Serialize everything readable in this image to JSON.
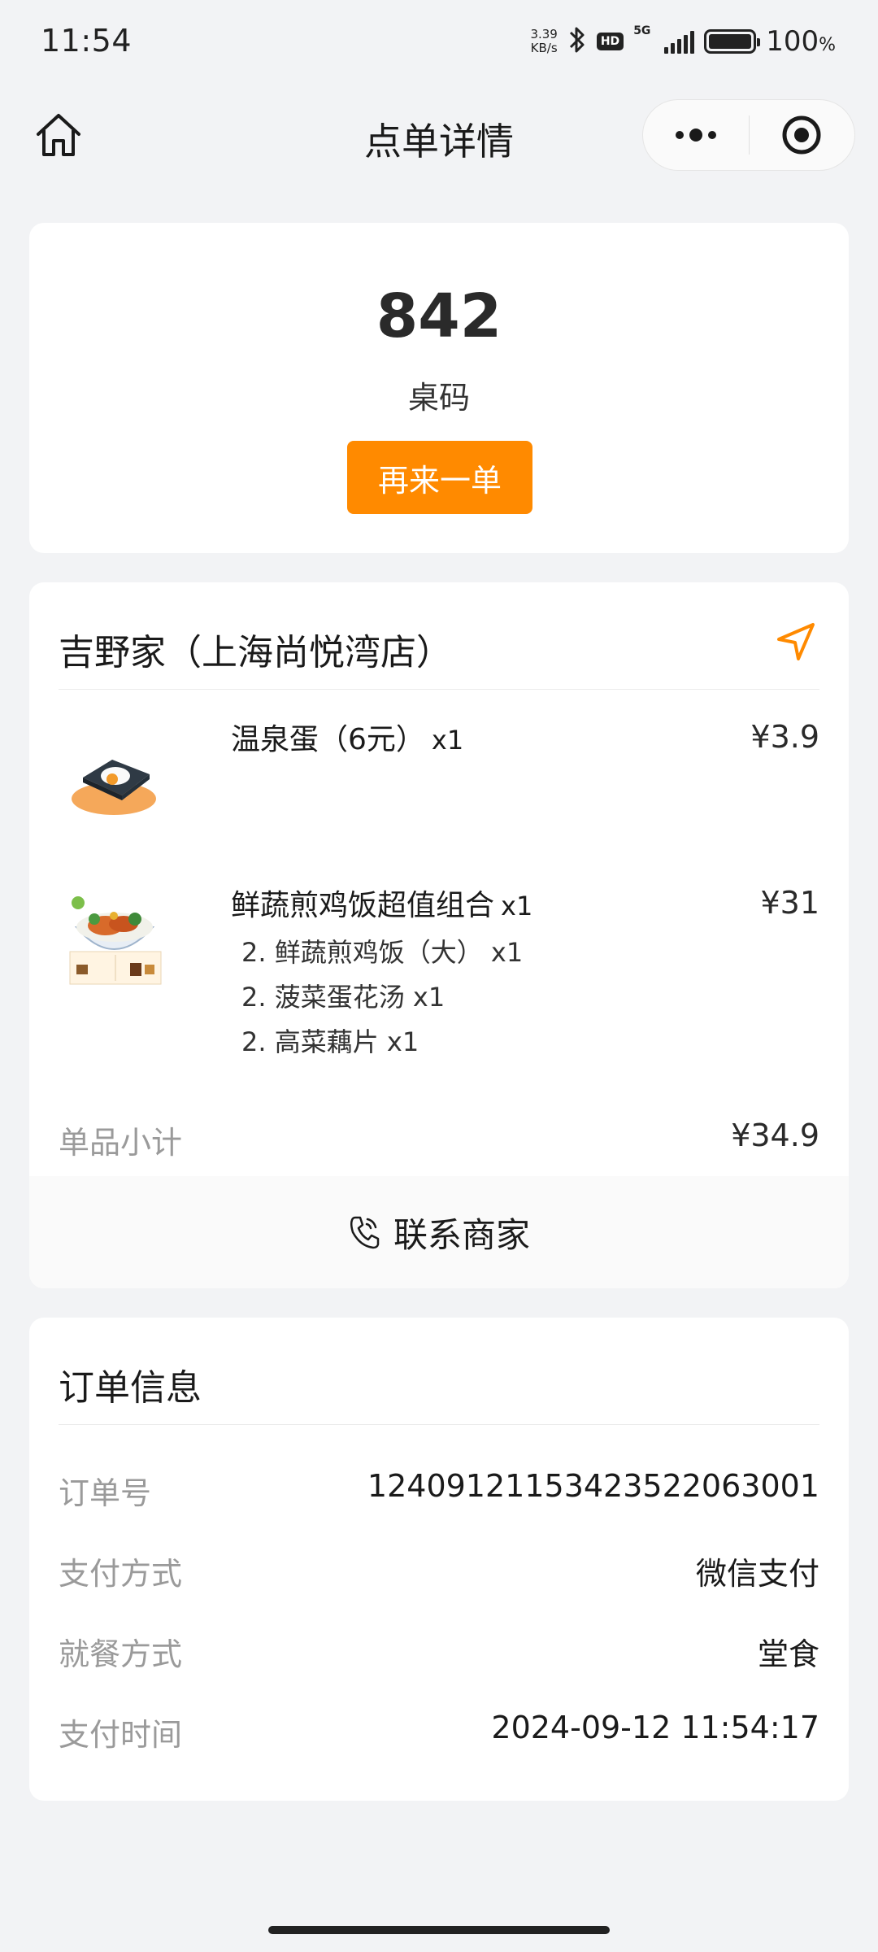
{
  "status_bar": {
    "time": "11:54",
    "net_speed_value": "3.39",
    "net_speed_unit": "KB/s",
    "hd": "HD",
    "network": "5G",
    "battery_percent": "100",
    "battery_unit": "%",
    "battery_level": 1.0
  },
  "nav": {
    "title": "点单详情",
    "icons": [
      "home-icon",
      "more-icon",
      "close-target-icon"
    ]
  },
  "table": {
    "number": "842",
    "label": "桌码",
    "reorder_label": "再来一单"
  },
  "order": {
    "store_name": "吉野家（上海尚悦湾店）",
    "items": [
      {
        "name": "温泉蛋（6元）",
        "qty": "x1",
        "price": "¥3.9",
        "icon": "egg-dish-image",
        "sub_items": []
      },
      {
        "name": "鲜蔬煎鸡饭超值组合",
        "qty": "x1",
        "price": "¥31",
        "icon": "chicken-rice-combo-image",
        "sub_items": [
          "2. 鲜蔬煎鸡饭（大） x1",
          "2. 菠菜蛋花汤 x1",
          "2. 高菜藕片 x1"
        ]
      }
    ],
    "subtotal_label": "单品小计",
    "subtotal_value": "¥34.9",
    "contact_label": "联系商家"
  },
  "info": {
    "title": "订单信息",
    "rows": [
      {
        "label": "订单号",
        "value": "1240912115342352206300​1"
      },
      {
        "label": "支付方式",
        "value": "微信支付"
      },
      {
        "label": "就餐方式",
        "value": "堂食"
      },
      {
        "label": "支付时间",
        "value": "2024-09-12 11:54:17"
      }
    ]
  },
  "colors": {
    "accent": "#ff8a00",
    "page_bg": "#f2f3f5",
    "card_bg": "#ffffff",
    "muted_text": "#9a9a9a"
  }
}
